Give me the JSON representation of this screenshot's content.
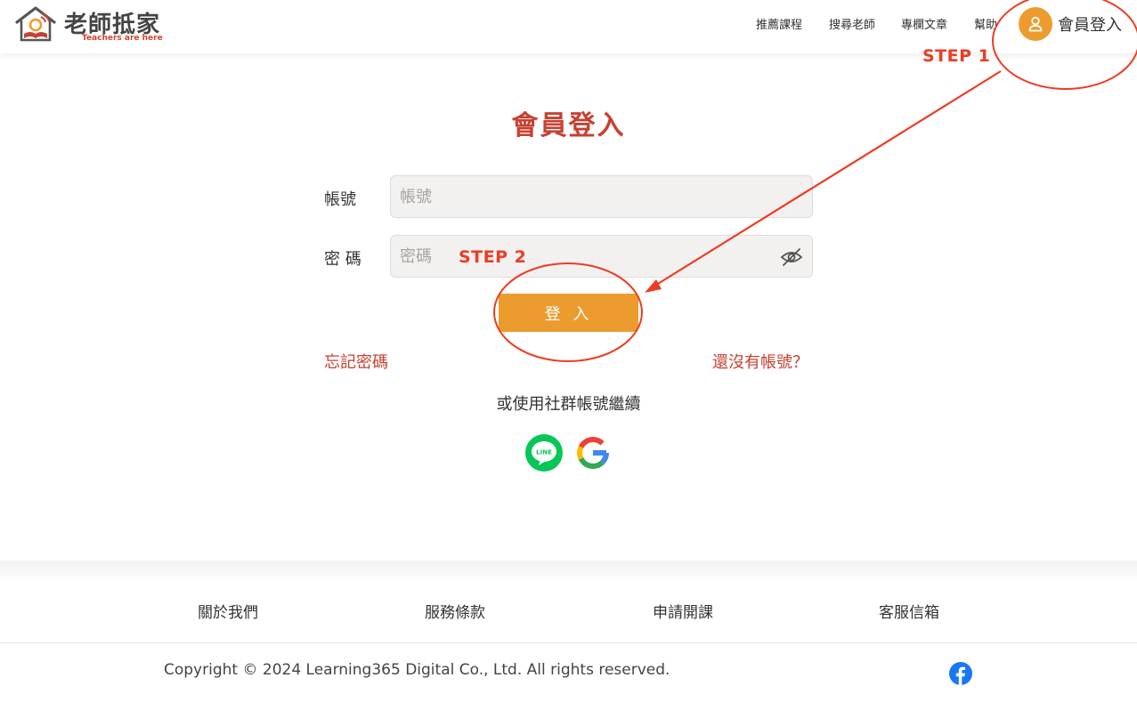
{
  "header": {
    "logo_title": "老師抵家",
    "logo_subtitle": "Teachers are here",
    "nav": [
      "推薦課程",
      "搜尋老師",
      "專欄文章",
      "幫助"
    ],
    "login_label": "會員登入"
  },
  "main": {
    "title": "會員登入",
    "account": {
      "label": "帳號",
      "placeholder": "帳號"
    },
    "password": {
      "label": "密 碼",
      "placeholder": "密碼"
    },
    "login_button": "登 入",
    "forgot_password": "忘記密碼",
    "register": "還沒有帳號？",
    "social_caption": "或使用社群帳號繼續"
  },
  "annotations": {
    "step1": "STEP 1",
    "step2": "STEP 2"
  },
  "footer": {
    "links": [
      "關於我們",
      "服務條款",
      "申請開課",
      "客服信箱"
    ],
    "copyright": "Copyright © 2024 Learning365 Digital Co., Ltd. All rights reserved."
  },
  "colors": {
    "brand_red": "#c64131",
    "brand_orange": "#ec9c2f",
    "annotation_red": "#ee3b24",
    "line_green": "#06c755",
    "facebook_blue": "#1877f2"
  }
}
